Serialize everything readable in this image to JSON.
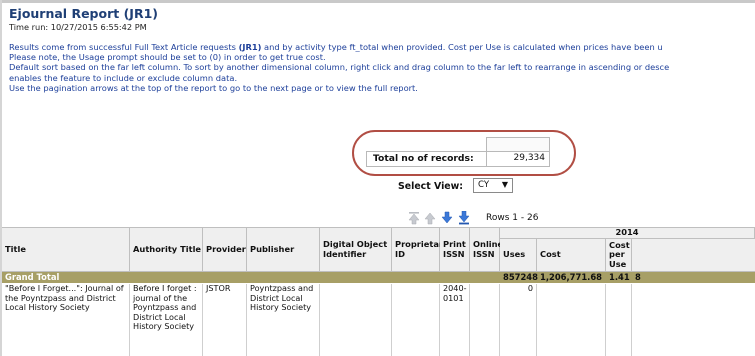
{
  "report": {
    "title": "Ejournal Report (JR1)",
    "time_run": "Time run: 10/27/2015 6:55:42 PM"
  },
  "intro": {
    "line1_pre": "Results come from successful Full Text Article requests ",
    "line1_bold": "(JR1)",
    "line1_post": " and by activity type ft_total when provided. Cost per Use is calculated when prices have been u",
    "line2": "Please note, the Usage prompt should be set to (0) in order to get true cost.",
    "line3": "Default sort based on the far left column. To sort by another dimensional column, right click and drag column to the far left to rearrange in ascending or desce",
    "line4": "enables the feature to include or exclude column data.",
    "line5": "Use the pagination arrows at the top of the report to go to the next page or to view the full report."
  },
  "totals": {
    "label": "Total no of records:",
    "value": "29,334"
  },
  "select_view": {
    "label": "Select View:",
    "value": "CY",
    "arrow": "▼"
  },
  "pager": {
    "rows_label": "Rows 1 - 26",
    "icons": [
      "page-first-icon",
      "page-up-icon",
      "page-down-icon",
      "page-last-icon"
    ]
  },
  "table": {
    "year": "2014",
    "columns": {
      "title": "Title",
      "authority_title": "Authority Title",
      "provider": "Provider",
      "publisher": "Publisher",
      "doi": "Digital Object Identifier",
      "proprietary_id": "Proprietary ID",
      "print_issn": "Print ISSN",
      "online_issn": "Online ISSN",
      "uses": "Uses",
      "cost": "Cost",
      "cost_per_use": "Cost per Use"
    },
    "grand_total": {
      "label": "Grand Total",
      "uses": "857248",
      "cost": "1,206,771.68",
      "cost_per_use": "1.41",
      "overflow": "8"
    },
    "rows": [
      {
        "title": "\"Before I Forget...\": Journal of the Poyntzpass and District Local History Society",
        "authority_title": "Before I forget : journal of the Poyntzpass and District Local History Society",
        "provider": "JSTOR",
        "publisher": "Poyntzpass and District Local History Society",
        "doi": "",
        "proprietary_id": "",
        "print_issn": "2040-0101",
        "online_issn": "",
        "uses": "0",
        "cost": "",
        "cost_per_use": ""
      }
    ]
  },
  "colors": {
    "title_blue": "#1f3f75",
    "intro_blue": "#1d3f9a",
    "grand_total_bar": "#a79f66",
    "highlight_oval": "#b14e44",
    "header_bg": "#efefef"
  }
}
